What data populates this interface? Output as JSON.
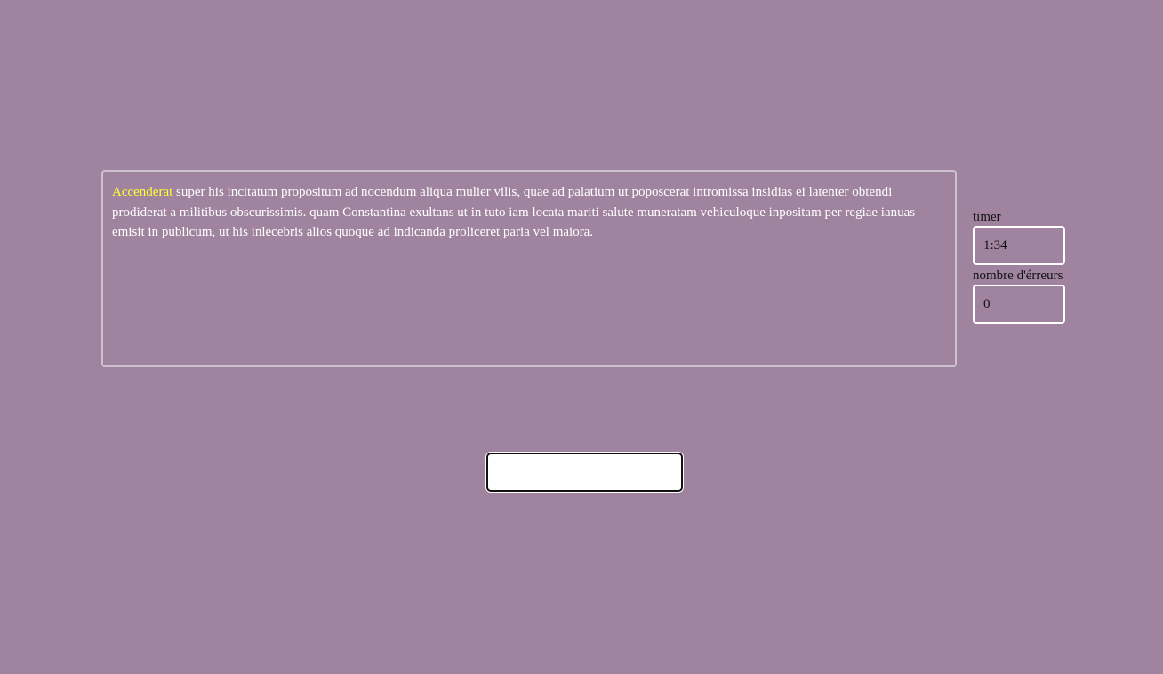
{
  "passage": {
    "current_word": "Accenderat",
    "remaining_text": " super his incitatum propositum ad nocendum aliqua mulier vilis, quae ad palatium ut poposcerat intromissa insidias ei latenter obtendi prodiderat a militibus obscurissimis. quam Constantina exultans ut in tuto iam locata mariti salute muneratam vehiculoque inpositam per regiae ianuas emisit in publicum, ut his inlecebris alios quoque ad indicanda proliceret paria vel maiora."
  },
  "stats": {
    "timer_label": "timer",
    "timer_value": "1:34",
    "errors_label": "nombre d'érreurs",
    "errors_value": "0"
  },
  "typing_input": {
    "value": ""
  },
  "colors": {
    "background": "#a0849f",
    "highlight": "#ffff33",
    "text": "#ffffff"
  }
}
